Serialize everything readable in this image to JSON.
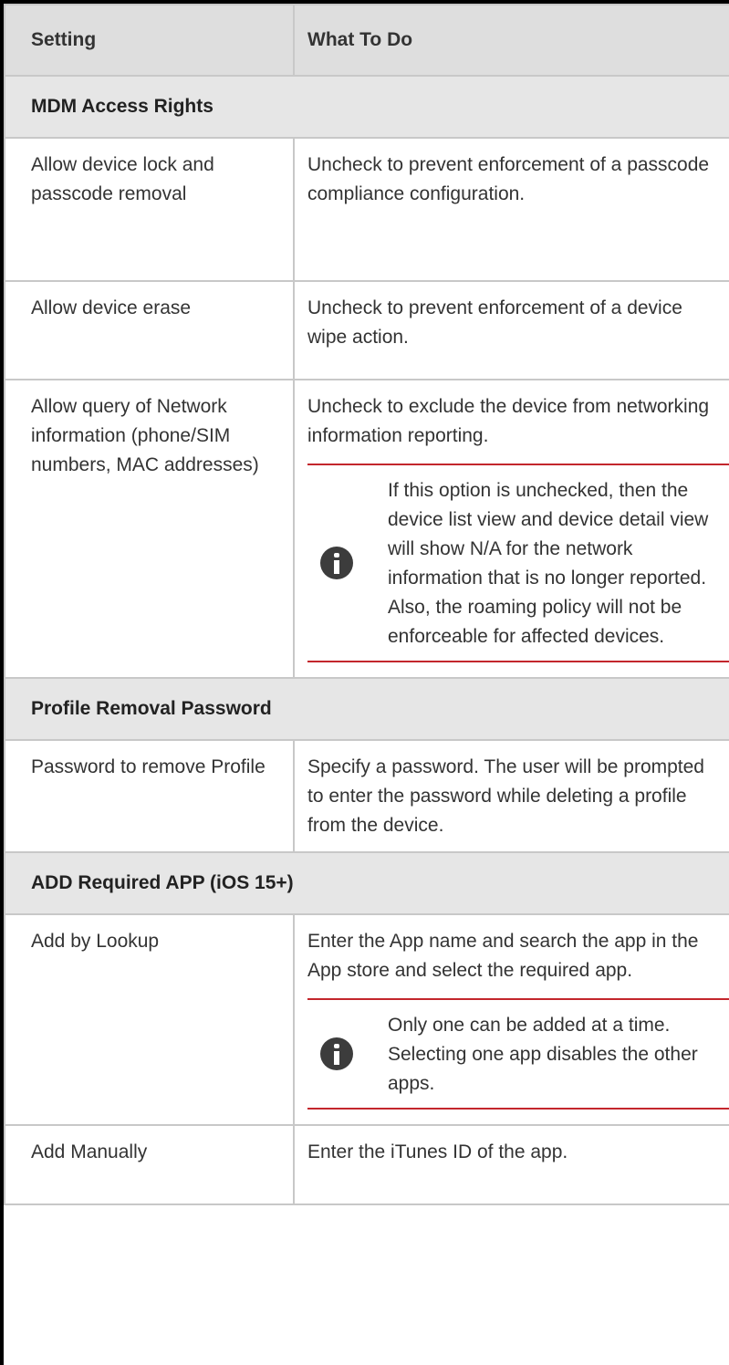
{
  "header": {
    "col1": "Setting",
    "col2": "What To Do"
  },
  "sections": [
    {
      "title": "MDM Access Rights",
      "rows": [
        {
          "setting": "Allow device lock and passcode removal",
          "action": "Uncheck to prevent enforcement of a passcode compliance configuration."
        },
        {
          "setting": "Allow device erase",
          "action": "Uncheck to prevent enforcement of a device wipe action."
        },
        {
          "setting": "Allow query of Network information (phone/SIM numbers, MAC addresses)",
          "action": "Uncheck to exclude the device from networking information reporting.",
          "note": "If this option is unchecked, then the device list view and device detail view will show N/A for the network information that is no longer reported. Also, the roaming policy will not be enforceable for affected devices."
        }
      ]
    },
    {
      "title": "Profile Removal Password",
      "rows": [
        {
          "setting": "Password to remove Profile",
          "action": "Specify a password. The user will be prompted to enter the password while deleting a profile from the device."
        }
      ]
    },
    {
      "title": "ADD Required APP (iOS 15+)",
      "rows": [
        {
          "setting": "Add by Lookup",
          "action": "Enter the App name and search the app in the App store and select the required app.",
          "note": "Only one can be added at a time. Selecting one app disables the other apps."
        },
        {
          "setting": "Add Manually",
          "action": "Enter the iTunes ID of the app."
        }
      ]
    }
  ],
  "icons": {
    "note": "info-icon"
  },
  "colors": {
    "header_bg": "#dedede",
    "section_bg": "#e6e6e6",
    "note_rule": "#c3262c",
    "icon_fill": "#3c3c3c"
  }
}
